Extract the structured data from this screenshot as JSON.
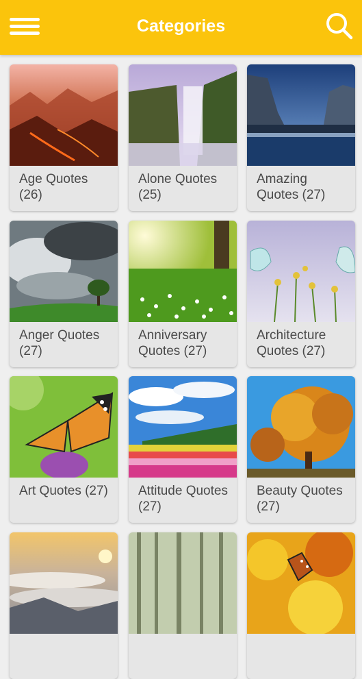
{
  "app_bar": {
    "title": "Categories",
    "menu_icon": "hamburger-menu-icon",
    "search_icon": "search-icon",
    "color": "#fbc40c"
  },
  "categories": [
    {
      "label": "Age Quotes (26)",
      "image": "volcanic-mountains"
    },
    {
      "label": "Alone Quotes (25)",
      "image": "waterfall"
    },
    {
      "label": "Amazing Quotes (27)",
      "image": "mountain-lake-night"
    },
    {
      "label": "Anger Quotes (27)",
      "image": "storm-clouds-tree"
    },
    {
      "label": "Anniversary Quotes (27)",
      "image": "sunny-meadow-flowers"
    },
    {
      "label": "Architecture Quotes (27)",
      "image": "butterflies-flowers"
    },
    {
      "label": "Art Quotes (27)",
      "image": "butterfly-on-thistle"
    },
    {
      "label": "Attitude Quotes (27)",
      "image": "flower-fields-sky"
    },
    {
      "label": "Beauty Quotes (27)",
      "image": "autumn-tree"
    },
    {
      "label": "",
      "image": "sunrise-above-clouds"
    },
    {
      "label": "",
      "image": "misty-forest"
    },
    {
      "label": "",
      "image": "butterfly-yellow-flowers"
    }
  ]
}
